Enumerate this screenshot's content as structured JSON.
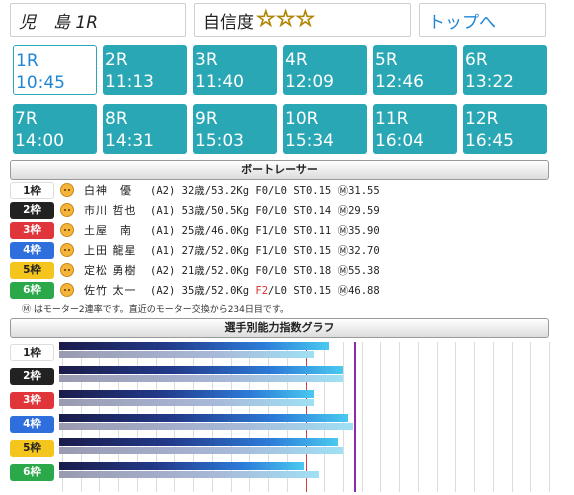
{
  "header": {
    "venue": "児　島 1R",
    "confidence_label": "自信度",
    "stars": [
      "☆",
      "☆",
      "☆"
    ],
    "home_link": "トップへ"
  },
  "races": [
    {
      "label": "1R",
      "time": "10:45",
      "selected": true
    },
    {
      "label": "2R",
      "time": "11:13"
    },
    {
      "label": "3R",
      "time": "11:40"
    },
    {
      "label": "4R",
      "time": "12:09"
    },
    {
      "label": "5R",
      "time": "12:46"
    },
    {
      "label": "6R",
      "time": "13:22"
    },
    {
      "label": "7R",
      "time": "14:00"
    },
    {
      "label": "8R",
      "time": "14:31"
    },
    {
      "label": "9R",
      "time": "15:03"
    },
    {
      "label": "10R",
      "time": "15:34"
    },
    {
      "label": "11R",
      "time": "16:04"
    },
    {
      "label": "12R",
      "time": "16:45"
    }
  ],
  "racers_header": "ボートレーサー",
  "racers": [
    {
      "waku": "1枠",
      "waku_bg": "#ffffff",
      "waku_fg": "#222222",
      "name": "白神　優",
      "cls": "(A2)",
      "age": "32",
      "weight": "/53.2Kg",
      "f": "F0",
      "l": "/L0",
      "st": "ST0.15",
      "motor": "Ⓜ31.55"
    },
    {
      "waku": "2枠",
      "waku_bg": "#222222",
      "waku_fg": "#ffffff",
      "name": "市川 哲也",
      "cls": "(A1)",
      "age": "53",
      "weight": "/50.5Kg",
      "f": "F0",
      "l": "/L0",
      "st": "ST0.14",
      "motor": "Ⓜ29.59"
    },
    {
      "waku": "3枠",
      "waku_bg": "#e0353b",
      "waku_fg": "#ffffff",
      "name": "土屋　南",
      "cls": "(A1)",
      "age": "25",
      "weight": "/46.0Kg",
      "f": "F1",
      "l": "/L0",
      "st": "ST0.11",
      "motor": "Ⓜ35.90"
    },
    {
      "waku": "4枠",
      "waku_bg": "#2f6fdd",
      "waku_fg": "#ffffff",
      "name": "上田 龍星",
      "cls": "(A1)",
      "age": "27",
      "weight": "/52.0Kg",
      "f": "F1",
      "l": "/L0",
      "st": "ST0.15",
      "motor": "Ⓜ32.70"
    },
    {
      "waku": "5枠",
      "waku_bg": "#f3c51d",
      "waku_fg": "#222222",
      "name": "定松 勇樹",
      "cls": "(A2)",
      "age": "21",
      "weight": "/52.0Kg",
      "f": "F0",
      "l": "/L0",
      "st": "ST0.18",
      "motor": "Ⓜ55.38"
    },
    {
      "waku": "6枠",
      "waku_bg": "#2aa84a",
      "waku_fg": "#ffffff",
      "name": "佐竹 太一",
      "cls": "(A2)",
      "age": "35",
      "weight": "/52.0Kg",
      "f": "F2",
      "f_red": true,
      "l": "/L0",
      "st": "ST0.15",
      "motor": "Ⓜ46.88"
    }
  ],
  "age_suffix": "歳",
  "note": "Ⓜ はモーター2連率です。直近のモーター交換から234日目です。",
  "graph_header": "選手別能力指数グラフ",
  "graph_values": [
    {
      "main": 0.55,
      "sub": 0.52
    },
    {
      "main": 0.58,
      "sub": 0.58
    },
    {
      "main": 0.52,
      "sub": 0.52
    },
    {
      "main": 0.59,
      "sub": 0.6
    },
    {
      "main": 0.57,
      "sub": 0.58
    },
    {
      "main": 0.5,
      "sub": 0.53
    }
  ]
}
